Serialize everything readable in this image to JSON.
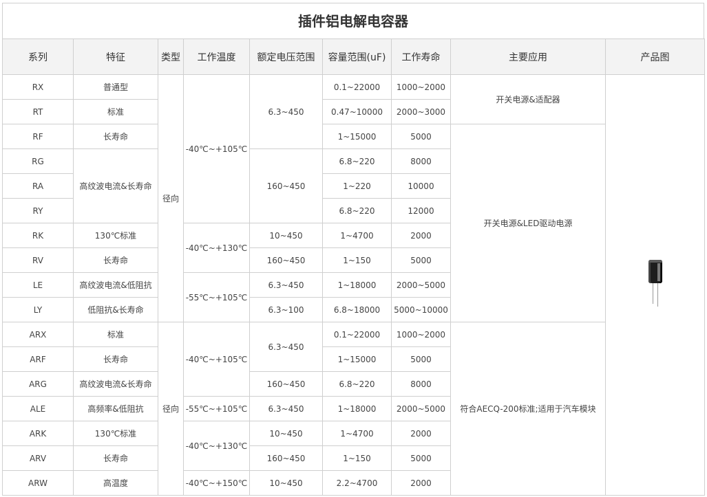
{
  "title": "插件铝电解电容器",
  "headers": [
    "系列",
    "特征",
    "类型",
    "工作温度",
    "额定电压范围",
    "容量范围(uF)",
    "工作寿命",
    "主要应用",
    "产品图"
  ],
  "rows": [
    {
      "series": "RX",
      "feature": "普通型",
      "capacitance": "0.1~22000",
      "life": "1000~2000"
    },
    {
      "series": "RT",
      "feature": "标准",
      "capacitance": "0.47~10000",
      "life": "2000~3000"
    },
    {
      "series": "RF",
      "feature": "长寿命",
      "capacitance": "1~15000",
      "life": "5000"
    },
    {
      "series": "RG",
      "capacitance": "6.8~220",
      "life": "8000"
    },
    {
      "series": "RA",
      "capacitance": "1~220",
      "life": "10000"
    },
    {
      "series": "RY",
      "capacitance": "6.8~220",
      "life": "12000"
    },
    {
      "series": "RK",
      "feature": "130℃标准",
      "capacitance": "1~4700",
      "life": "2000"
    },
    {
      "series": "RV",
      "feature": "长寿命",
      "capacitance": "1~150",
      "life": "5000"
    },
    {
      "series": "LE",
      "feature": "高纹波电流&低阻抗",
      "capacitance": "1~18000",
      "life": "2000~5000"
    },
    {
      "series": "LY",
      "feature": "低阻抗&长寿命",
      "capacitance": "6.8~18000",
      "life": "5000~10000"
    },
    {
      "series": "ARX",
      "feature": "标准",
      "capacitance": "0.1~22000",
      "life": "1000~2000"
    },
    {
      "series": "ARF",
      "feature": "长寿命",
      "capacitance": "1~15000",
      "life": "5000"
    },
    {
      "series": "ARG",
      "feature": "高纹波电流&长寿命",
      "capacitance": "6.8~220",
      "life": "8000"
    },
    {
      "series": "ALE",
      "feature": "高频率&低阻抗",
      "capacitance": "1~18000",
      "life": "2000~5000"
    },
    {
      "series": "ARK",
      "feature": "130℃标准",
      "capacitance": "1~4700",
      "life": "2000"
    },
    {
      "series": "ARV",
      "feature": "长寿命",
      "capacitance": "1~150",
      "life": "5000"
    },
    {
      "series": "ARW",
      "feature": "高温度",
      "capacitance": "2.2~4700",
      "life": "2000"
    }
  ],
  "merged": {
    "feature_rg_ry": "高纹波电流&长寿命",
    "type_radial_1": "径向",
    "type_radial_2": "径向",
    "temp_1": "-40℃~+105℃",
    "temp_2": "-40℃~+130℃",
    "temp_3": "-55℃~+105℃",
    "temp_4": "-40℃~+105℃",
    "temp_5": "-55℃~+105℃",
    "temp_6": "-40℃~+130℃",
    "temp_7": "-40℃~+150℃",
    "volt_1": "6.3~450",
    "volt_2": "160~450",
    "volt_3": "10~450",
    "volt_4": "160~450",
    "volt_5": "6.3~450",
    "volt_6": "6.3~100",
    "volt_7": "6.3~450",
    "volt_8": "160~450",
    "volt_9": "6.3~450",
    "volt_10": "10~450",
    "volt_11": "160~450",
    "volt_12": "10~450",
    "app_1": "开关电源&适配器",
    "app_2": "开关电源&LED驱动电源",
    "app_3": "符合AECQ-200标准;适用于汽车模块"
  },
  "product_image": "electrolytic-capacitor-icon"
}
